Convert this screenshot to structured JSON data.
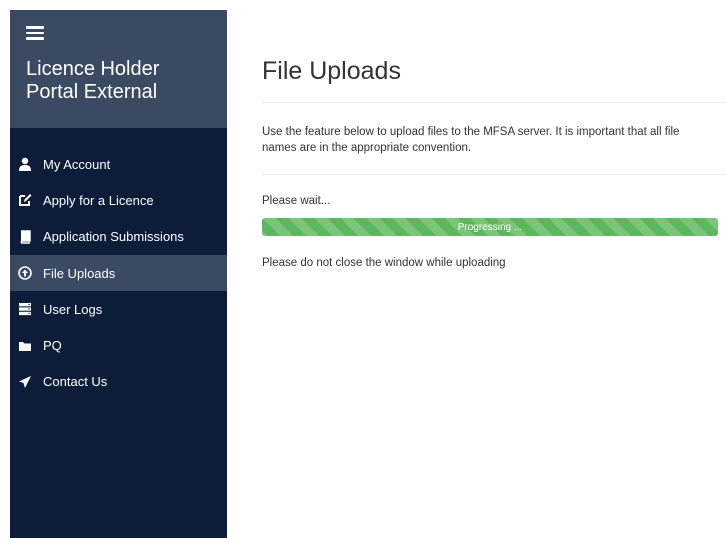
{
  "sidebar": {
    "title_line1": "Licence Holder",
    "title_line2": "Portal External",
    "items": [
      {
        "label": "My Account",
        "icon": "user-icon",
        "active": false
      },
      {
        "label": "Apply for a Licence",
        "icon": "edit-icon",
        "active": false
      },
      {
        "label": "Application Submissions",
        "icon": "book-icon",
        "active": false
      },
      {
        "label": "File Uploads",
        "icon": "upload-circle-icon",
        "active": true
      },
      {
        "label": "User Logs",
        "icon": "server-icon",
        "active": false
      },
      {
        "label": "PQ",
        "icon": "folder-icon",
        "active": false
      },
      {
        "label": "Contact Us",
        "icon": "send-icon",
        "active": false
      }
    ]
  },
  "main": {
    "title": "File Uploads",
    "intro": "Use the feature below to upload files to the MFSA server. It is important that all file names are in the appropriate convention.",
    "status": "Please wait...",
    "progress": {
      "label": "Progressing ...",
      "percent": 100
    },
    "note": "Please do not close the window while uploading"
  },
  "colors": {
    "sidebar_bg": "#0c1d39",
    "sidebar_header_bg": "#3a4a62",
    "active_item_bg": "#3a4a62",
    "progress_green": "#5cb85c"
  }
}
